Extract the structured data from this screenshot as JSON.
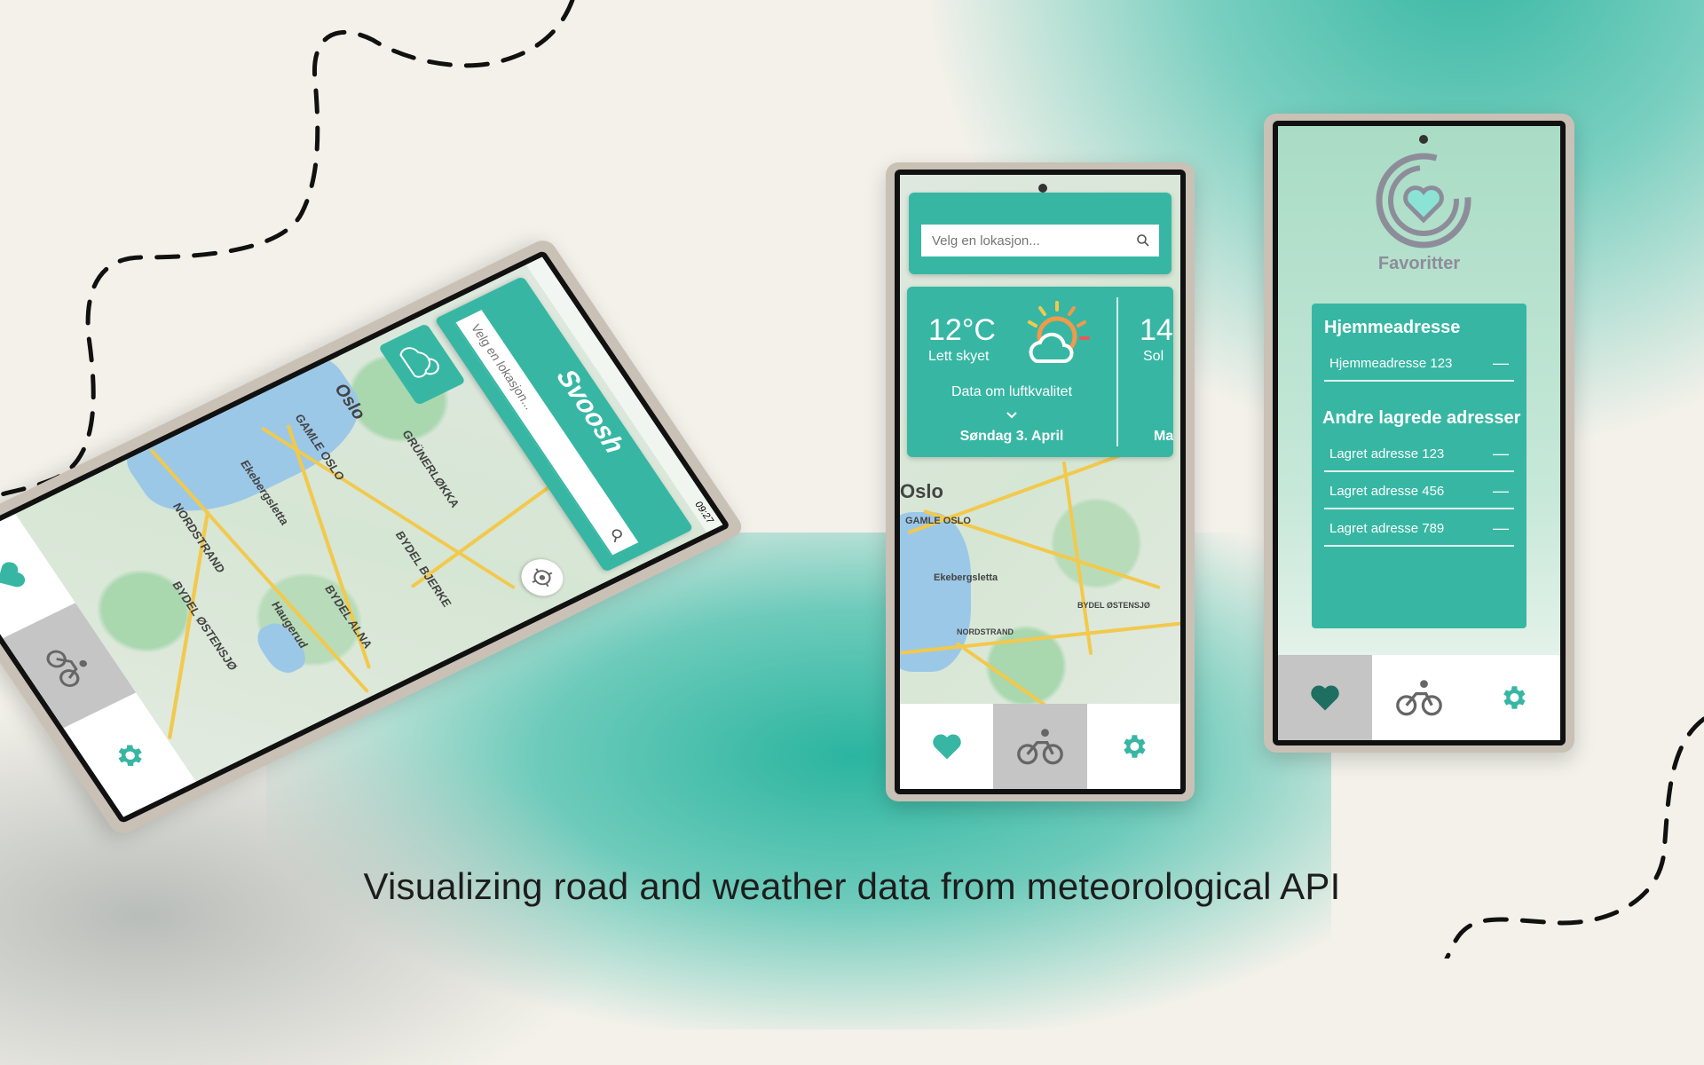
{
  "caption": "Visualizing road and weather data from meteorological API",
  "colors": {
    "accent": "#37b7a3",
    "nav_active": "#c5c5c5",
    "background": "#f3f1ea"
  },
  "phone1": {
    "brand": "Svoosh",
    "status_time": "09:27",
    "search_placeholder": "Velg en lokasjon...",
    "map_labels": [
      "Oslo",
      "GRÜNERLØKKA",
      "BYDEL BJERKE",
      "GAMLE OSLO",
      "BYDEL ALNA",
      "Ekebergsletta",
      "Haugerud",
      "NORDSTRAND",
      "BYDEL ØSTENSJØ"
    ],
    "icons": [
      "cloud-sun-icon",
      "location-target-icon",
      "search-icon"
    ]
  },
  "phone2": {
    "search_placeholder": "Velg en lokasjon...",
    "weather_today": {
      "temperature": "12°C",
      "condition": "Lett skyet",
      "air_quality_label": "Data om luftkvalitet",
      "date": "Søndag 3. April"
    },
    "weather_next": {
      "temperature": "14",
      "condition": "Sol",
      "date": "Ma"
    },
    "map_labels": [
      "Oslo",
      "GAMLE OSLO",
      "Ekebergsletta",
      "BYDEL ØSTENSJØ",
      "NORDSTRAND"
    ]
  },
  "phone3": {
    "title": "Favoritter",
    "home_heading": "Hjemmeadresse",
    "home_address": "Hjemmeadresse 123",
    "saved_heading": "Andre lagrede adresser",
    "saved_addresses": [
      "Lagret adresse 123",
      "Lagret adresse 456",
      "Lagret adresse 789"
    ],
    "remove_symbol": "—"
  },
  "navbar": {
    "items": [
      "favorites",
      "cycling",
      "settings"
    ]
  }
}
